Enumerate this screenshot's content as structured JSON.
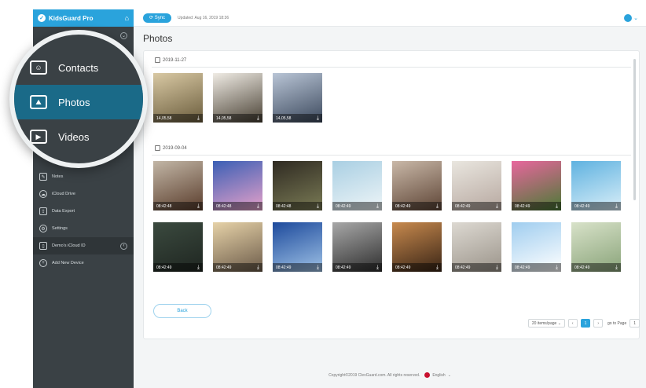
{
  "brand": {
    "name": "KidsGuard Pro"
  },
  "header": {
    "sync_label": "Sync",
    "updated": "Updated: Aug 16, 2019 18:36"
  },
  "sidebar": {
    "device": "Demo's iCloud ID",
    "items": [
      {
        "label": "Notes",
        "icon": "notes-icon"
      },
      {
        "label": "iCloud Drive",
        "icon": "cloud-icon"
      },
      {
        "label": "Data Export",
        "icon": "export-icon"
      },
      {
        "label": "Settings",
        "icon": "gear-icon"
      },
      {
        "label": "Demo's iCloud ID",
        "icon": "device-icon"
      },
      {
        "label": "Add New Device",
        "icon": "plus-icon"
      }
    ]
  },
  "magnifier": {
    "items": [
      {
        "label": "Contacts",
        "icon": "contacts-icon"
      },
      {
        "label": "Photos",
        "icon": "photos-icon",
        "active": true
      },
      {
        "label": "Videos",
        "icon": "videos-icon"
      }
    ]
  },
  "main": {
    "title": "Photos",
    "groups": [
      {
        "date": "2019-11-27",
        "photos": [
          {
            "time": "14,05,58",
            "colors": [
              "#d9c9a4",
              "#6b5d3d"
            ]
          },
          {
            "time": "14,05,58",
            "colors": [
              "#f0ece5",
              "#4a4235"
            ]
          },
          {
            "time": "14,05,58",
            "colors": [
              "#b9c5d6",
              "#3d4a5e"
            ]
          }
        ]
      },
      {
        "date": "2019-09-04",
        "photos": [
          {
            "time": "08:42:48",
            "colors": [
              "#c2b6a6",
              "#5a3d2c"
            ]
          },
          {
            "time": "08:42:48",
            "colors": [
              "#3b5fb5",
              "#e6a1c9"
            ]
          },
          {
            "time": "08:42:48",
            "colors": [
              "#2f2a22",
              "#7a7b55"
            ]
          },
          {
            "time": "08:42:49",
            "colors": [
              "#a9cfe3",
              "#eef5f7"
            ]
          },
          {
            "time": "08:42:49",
            "colors": [
              "#c9b8a8",
              "#5e4536"
            ]
          },
          {
            "time": "08:42:49",
            "colors": [
              "#e9e6df",
              "#b7a8a0"
            ]
          },
          {
            "time": "08:42:49",
            "colors": [
              "#e8669d",
              "#4a7a35"
            ]
          },
          {
            "time": "08:42:49",
            "colors": [
              "#5fb2e0",
              "#d9eef8"
            ]
          },
          {
            "time": "08:42:49",
            "colors": [
              "#3b4a3f",
              "#1f2621"
            ]
          },
          {
            "time": "08:42:49",
            "colors": [
              "#e6d2a8",
              "#6d5c4a"
            ]
          },
          {
            "time": "08:42:49",
            "colors": [
              "#1d4a9c",
              "#9ec1e5"
            ]
          },
          {
            "time": "08:42:49",
            "colors": [
              "#a8a8a8",
              "#2f2f2f"
            ]
          },
          {
            "time": "08:42:49",
            "colors": [
              "#c88a4e",
              "#3a2516"
            ]
          },
          {
            "time": "08:42:49",
            "colors": [
              "#ddd9d2",
              "#9b948a"
            ]
          },
          {
            "time": "08:42:49",
            "colors": [
              "#9fcdef",
              "#ffffff"
            ]
          },
          {
            "time": "08:42:49",
            "colors": [
              "#d8e2c9",
              "#8aa47a"
            ]
          }
        ]
      }
    ],
    "back_label": "Back"
  },
  "pager": {
    "per_page": "20 items/page",
    "current": "1",
    "goto_label": "go to Page",
    "goto_value": "1"
  },
  "footer": {
    "copyright": "Copyright©2019 ClevGuard.com. All rights reserved.",
    "language": "English"
  },
  "colors": {
    "accent": "#2aa3dc",
    "sidebar": "#3a4145"
  }
}
